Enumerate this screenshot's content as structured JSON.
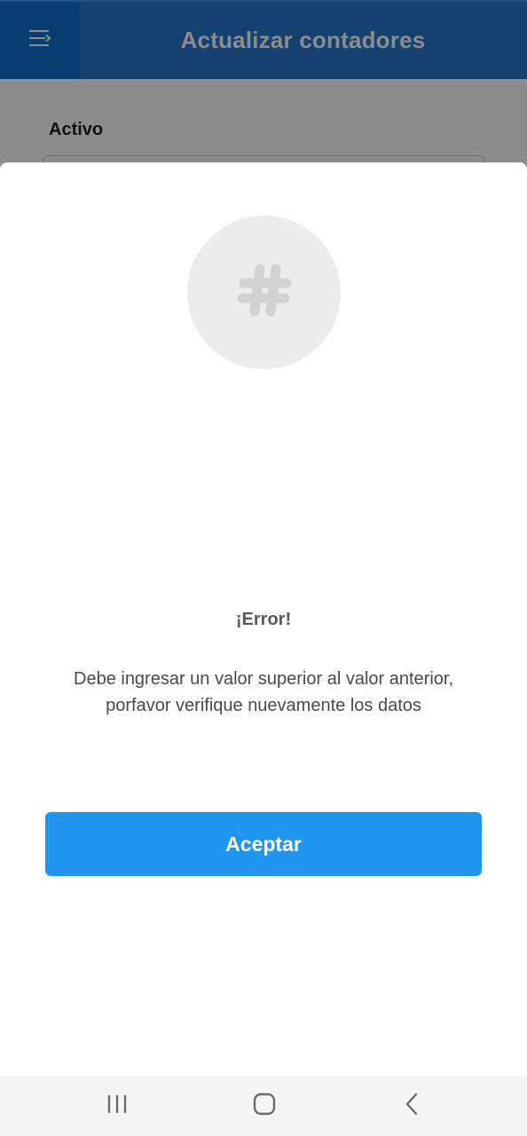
{
  "app_bar": {
    "title": "Actualizar contadores",
    "menu_icon": "menu-icon",
    "background_color": "#2577cc",
    "menu_button_color": "#0f6fd0"
  },
  "page": {
    "field_label": "Activo"
  },
  "dialog": {
    "icon": "hashtag-icon",
    "title": "¡Error!",
    "message": "Debe ingresar un valor superior al valor anterior, porfavor verifique nuevamente los datos",
    "accept_label": "Aceptar",
    "accept_color": "#2196f0"
  },
  "system_nav": {
    "recents_icon": "recents-icon",
    "home_icon": "home-icon",
    "back_icon": "back-icon"
  }
}
